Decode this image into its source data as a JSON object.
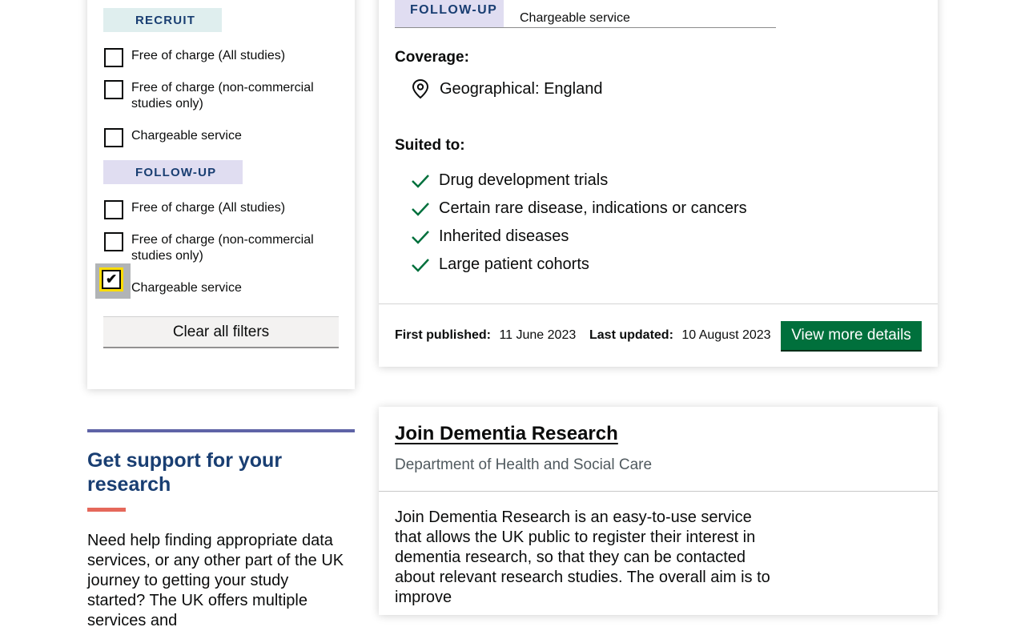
{
  "filters": {
    "recruit_tag": "RECRUIT",
    "recruit_options": [
      {
        "label": "Free of charge (All studies)",
        "checked": false
      },
      {
        "label": "Free of charge (non-commercial studies only)",
        "checked": false
      },
      {
        "label": "Chargeable service",
        "checked": false
      }
    ],
    "followup_tag": "FOLLOW-UP",
    "followup_options": [
      {
        "label": "Free of charge (All studies)",
        "checked": false
      },
      {
        "label": "Free of charge (non-commercial studies only)",
        "checked": false
      },
      {
        "label": "Chargeable service",
        "checked": true
      }
    ],
    "clear_label": "Clear all filters"
  },
  "support": {
    "title": "Get support for your research",
    "body": "Need help finding appropriate data services, or any other part of the UK journey to getting your study started? The UK offers multiple services and"
  },
  "card1": {
    "cost_tag": "FOLLOW-UP",
    "cost_value": "Chargeable service",
    "coverage_heading": "Coverage:",
    "coverage_value": "Geographical: England",
    "suited_heading": "Suited to:",
    "suited_items": [
      "Drug development trials",
      "Certain rare disease, indications or cancers",
      "Inherited diseases",
      "Large patient cohorts"
    ],
    "first_published_label": "First published:",
    "first_published_value": "11 June 2023",
    "last_updated_label": "Last updated:",
    "last_updated_value": "10 August 2023",
    "view_label": "View more details"
  },
  "card2": {
    "title": "Join Dementia Research",
    "org": "Department of Health and Social Care",
    "description": "Join Dementia Research is an easy-to-use service that allows the UK public to register their interest in dementia research, so that they can be contacted about relevant research studies. The overall aim is to improve"
  },
  "colors": {
    "tag_text": "#193e72",
    "recruit_bg": "#dfeeee",
    "followup_bg": "#e0ddf1",
    "success_green": "#00703c",
    "focus_yellow": "#ffdd00",
    "support_rule": "#5e63a6",
    "support_accent": "#e5685b"
  }
}
